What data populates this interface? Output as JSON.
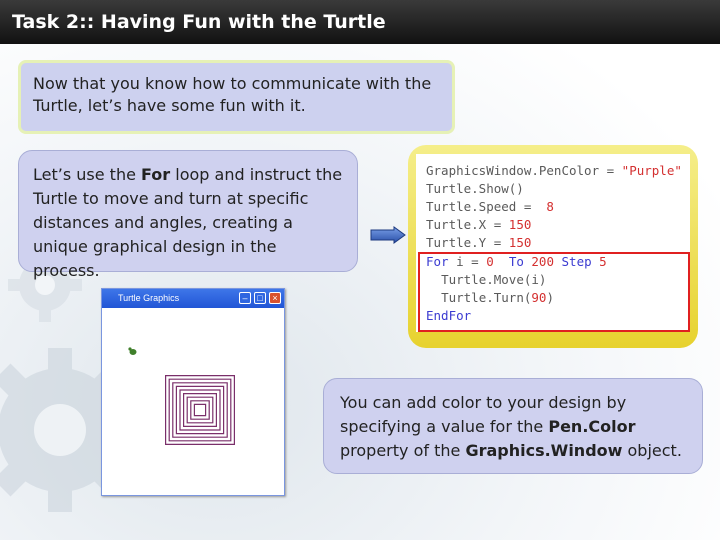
{
  "slide": {
    "title": "Task 2:: Having Fun with the Turtle"
  },
  "intro_box": {
    "text": "Now that you know how to communicate with the Turtle, let’s have some fun with it."
  },
  "for_box": {
    "pre": "Let’s use the ",
    "bold": "For",
    "post": " loop and instruct the Turtle to move and turn at specific distances and angles, creating a unique graphical design in the process."
  },
  "color_box": {
    "pre": "You can add color to your design by specifying a value for the ",
    "bold1": "Pen.Color",
    "mid": " property of the ",
    "bold2": "Graphics.Window",
    "post": " object."
  },
  "code": {
    "l1a": "GraphicsWindow.PenColor = ",
    "l1b": "\"Purple\"",
    "l2": "Turtle.Show()",
    "l3a": "Turtle.Speed = ",
    "l3b": "8",
    "l4a": "Turtle.X = ",
    "l4b": "150",
    "l5a": "Turtle.Y = ",
    "l5b": "150",
    "l6a": "For",
    "l6b": " i = ",
    "l6c": "0",
    "l6d": "To",
    "l6e": "200",
    "l6f": "Step",
    "l6g": "5",
    "l7": "Turtle.Move(i)",
    "l8a": "Turtle.Turn(",
    "l8b": "90",
    "l8c": ")",
    "l9": "EndFor"
  },
  "turtle_window": {
    "title": "Turtle Graphics",
    "pen_color": "#7a2f6a"
  },
  "colors": {
    "keyword": "#3b3bd1",
    "number": "#d43030",
    "highlight": "#e02020"
  }
}
